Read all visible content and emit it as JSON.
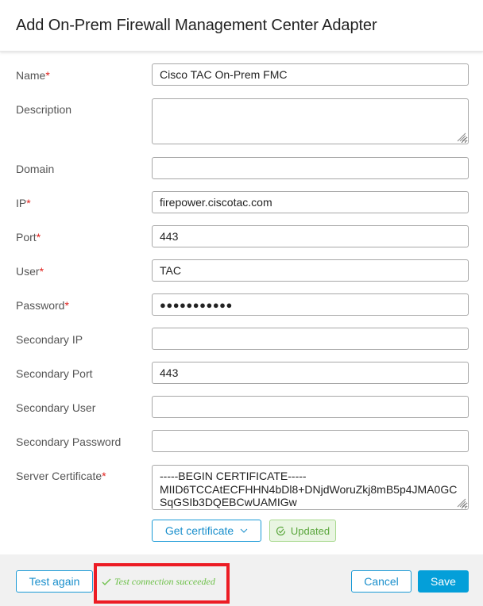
{
  "dialog": {
    "title": "Add On-Prem Firewall Management Center Adapter"
  },
  "form": {
    "required_marker": "*",
    "fields": {
      "name": {
        "label": "Name",
        "value": "Cisco TAC On-Prem FMC",
        "required": true
      },
      "description": {
        "label": "Description",
        "value": "",
        "required": false
      },
      "domain": {
        "label": "Domain",
        "value": "",
        "required": false
      },
      "ip": {
        "label": "IP",
        "value": "firepower.ciscotac.com",
        "required": true
      },
      "port": {
        "label": "Port",
        "value": "443",
        "required": true
      },
      "user": {
        "label": "User",
        "value": "TAC",
        "required": true
      },
      "password": {
        "label": "Password",
        "value": "●●●●●●●●●●●",
        "required": true
      },
      "secondary_ip": {
        "label": "Secondary IP",
        "value": "",
        "required": false
      },
      "secondary_port": {
        "label": "Secondary Port",
        "value": "443",
        "required": false
      },
      "secondary_user": {
        "label": "Secondary User",
        "value": "",
        "required": false
      },
      "secondary_password": {
        "label": "Secondary Password",
        "value": "",
        "required": false
      },
      "server_certificate": {
        "label": "Server Certificate",
        "value": "-----BEGIN CERTIFICATE-----\nMIID6TCCAtECFHHN4bDl8+DNjdWoruZkj8mB5p4JMA0GC\nSqGSIb3DQEBCwUAMIGw",
        "required": true
      }
    },
    "get_certificate_button": {
      "label": "Get certificate",
      "icon": "chevron-down-icon"
    },
    "certificate_status": {
      "label": "Updated",
      "icon": "check-circle-icon"
    }
  },
  "footer": {
    "test_again_label": "Test again",
    "test_status": {
      "text": "Test connection succeeded",
      "icon": "checkmark-icon"
    },
    "cancel_label": "Cancel",
    "save_label": "Save"
  },
  "colors": {
    "primary": "#049fd9",
    "required": "#e0201c",
    "success": "#6abf45",
    "highlight_box": "#ec1c24"
  }
}
